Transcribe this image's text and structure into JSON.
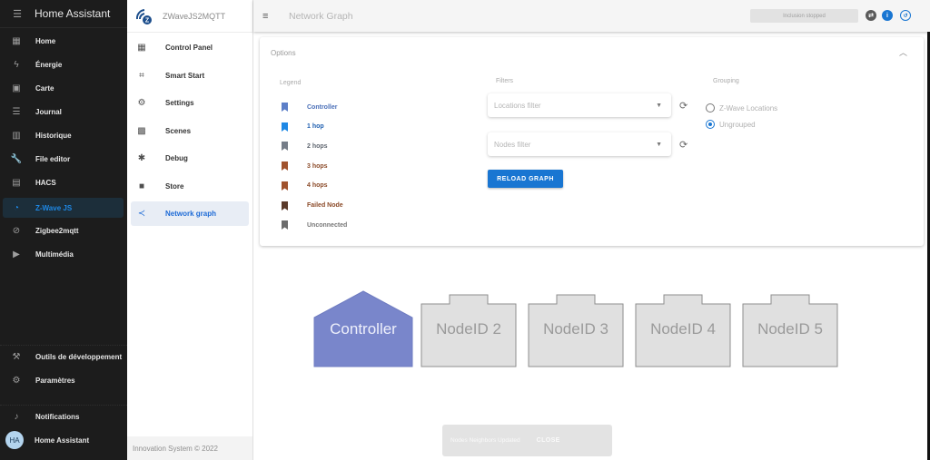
{
  "ha_sidebar": {
    "title": "Home Assistant",
    "menu_icon": "menu-collapse-icon",
    "items": [
      {
        "label": "Home",
        "icon": "dashboard-icon",
        "glyph": "▦"
      },
      {
        "label": "Énergie",
        "icon": "lightning-icon",
        "glyph": "ϟ"
      },
      {
        "label": "Carte",
        "icon": "map-icon",
        "glyph": "▣"
      },
      {
        "label": "Journal",
        "icon": "list-icon",
        "glyph": "☰"
      },
      {
        "label": "Historique",
        "icon": "chart-box-icon",
        "glyph": "▥"
      },
      {
        "label": "File editor",
        "icon": "wrench-icon",
        "glyph": "🔧"
      },
      {
        "label": "HACS",
        "icon": "hacs-icon",
        "glyph": "▤"
      },
      {
        "label": "Z-Wave JS",
        "icon": "zwave-icon",
        "glyph": "◔",
        "active": true
      },
      {
        "label": "Zigbee2mqtt",
        "icon": "zigbee-icon",
        "glyph": "⊘"
      },
      {
        "label": "Multimédia",
        "icon": "media-icon",
        "glyph": "▶"
      }
    ],
    "bottom_items": [
      {
        "label": "Outils de développement",
        "icon": "hammer-icon",
        "glyph": "⚒"
      },
      {
        "label": "Paramètres",
        "icon": "cog-icon",
        "glyph": "⚙"
      }
    ],
    "notifications": {
      "label": "Notifications",
      "icon": "bell-icon",
      "glyph": "🔔"
    },
    "user": {
      "label": "Home Assistant",
      "initials": "HA"
    }
  },
  "app_sidebar": {
    "title": "ZWaveJS2MQTT",
    "items": [
      {
        "label": "Control Panel",
        "icon": "view-dashboard-icon",
        "glyph": "▦"
      },
      {
        "label": "Smart Start",
        "icon": "qrcode-scan-icon",
        "glyph": "⌗"
      },
      {
        "label": "Settings",
        "icon": "settings-icon",
        "glyph": "⚙"
      },
      {
        "label": "Scenes",
        "icon": "scenes-icon",
        "glyph": "▩"
      },
      {
        "label": "Debug",
        "icon": "bug-icon",
        "glyph": "✱"
      },
      {
        "label": "Store",
        "icon": "folder-icon",
        "glyph": "■"
      },
      {
        "label": "Network graph",
        "icon": "share-icon",
        "glyph": "≺",
        "active": true
      }
    ],
    "footer": "Innovation System © 2022"
  },
  "topbar": {
    "title": "Network Graph",
    "inclusion_status": "Inclusion stopped",
    "icons": [
      "swap-icon",
      "info-icon",
      "restart-icon"
    ]
  },
  "options": {
    "title": "Options",
    "legend": {
      "label": "Legend",
      "items": [
        {
          "label": "Controller",
          "color": "#5c7fc8",
          "text_color": "#4a6fb8"
        },
        {
          "label": "1 hop",
          "color": "#1e88e5",
          "text_color": "#1e5fb0"
        },
        {
          "label": "2 hops",
          "color": "#757d88",
          "text_color": "#5f6670"
        },
        {
          "label": "3 hops",
          "color": "#a0522d",
          "text_color": "#8b4a28"
        },
        {
          "label": "4 hops",
          "color": "#a0522d",
          "text_color": "#8b4a28"
        },
        {
          "label": "Failed Node",
          "color": "#5a3a2a",
          "text_color": "#8b4a28"
        },
        {
          "label": "Unconnected",
          "color": "#6b6b6b",
          "text_color": "#777777"
        }
      ]
    },
    "filters": {
      "label": "Filters",
      "locations_placeholder": "Locations filter",
      "nodes_placeholder": "Nodes filter",
      "reload_label": "RELOAD GRAPH"
    },
    "grouping": {
      "label": "Grouping",
      "options": [
        {
          "label": "Z-Wave Locations",
          "checked": false
        },
        {
          "label": "Ungrouped",
          "checked": true
        }
      ]
    }
  },
  "graph": {
    "nodes": [
      {
        "label": "Controller",
        "type": "controller",
        "color": "#7986cb"
      },
      {
        "label": "NodeID 2",
        "type": "node",
        "color": "#e0e0e0"
      },
      {
        "label": "NodeID 3",
        "type": "node",
        "color": "#e0e0e0"
      },
      {
        "label": "NodeID 4",
        "type": "node",
        "color": "#e0e0e0"
      },
      {
        "label": "NodeID 5",
        "type": "node",
        "color": "#e0e0e0"
      }
    ]
  },
  "snackbar": {
    "message": "Nodes Neighbors Updated",
    "close_label": "CLOSE"
  },
  "colors": {
    "accent": "#1976d2",
    "sidebar_bg": "#1c1c1c"
  }
}
